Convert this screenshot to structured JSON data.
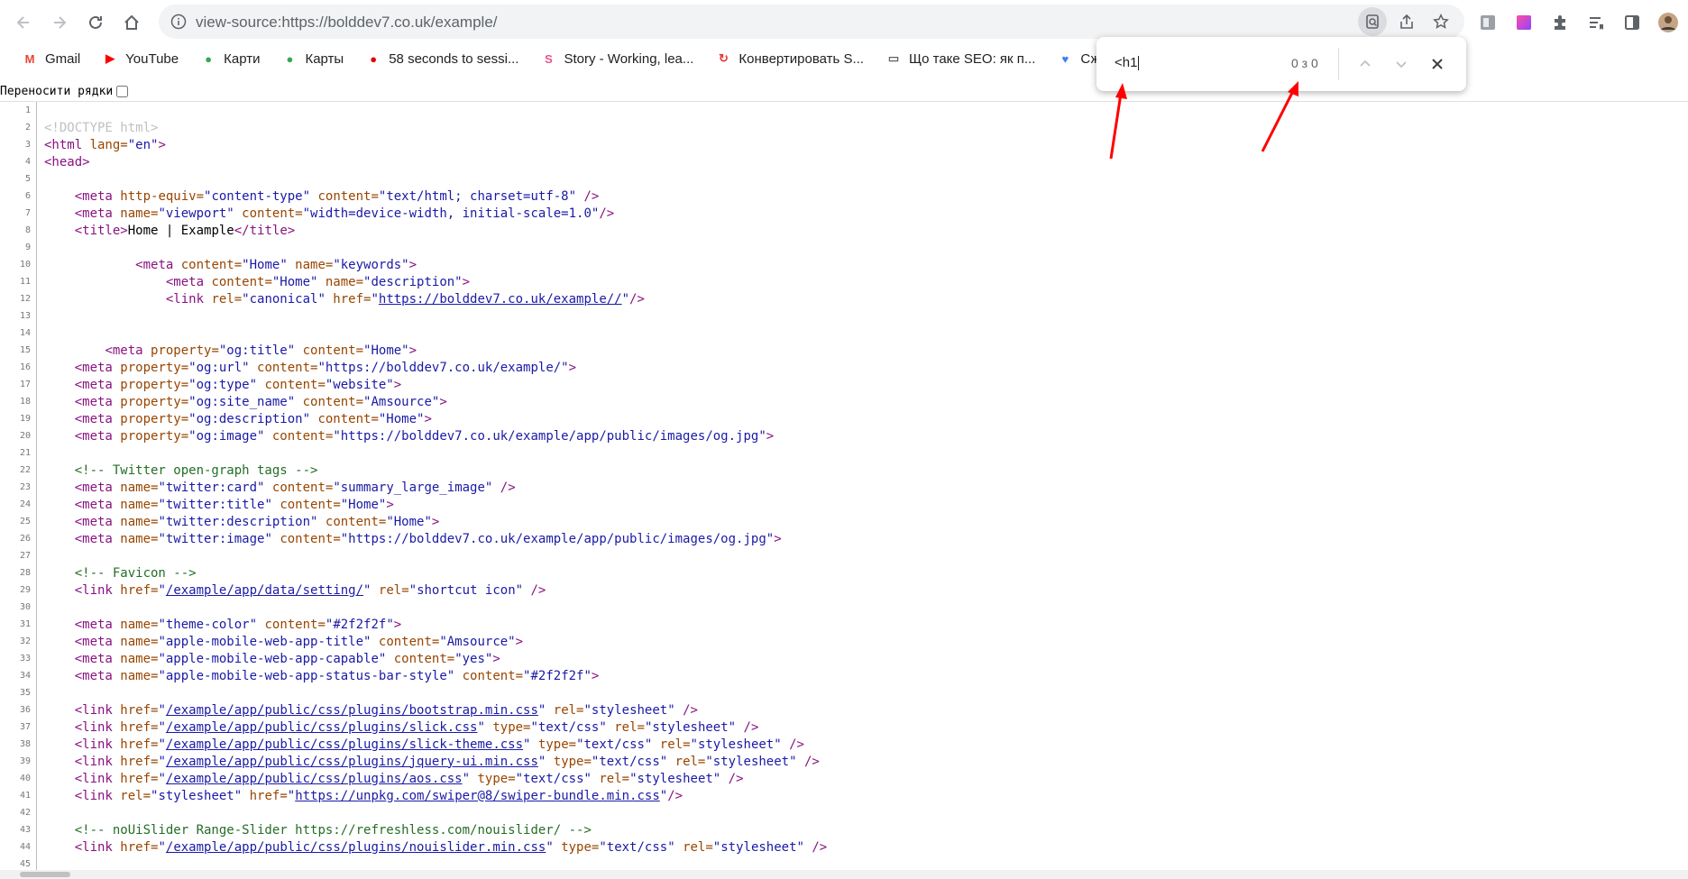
{
  "browser": {
    "url": "view-source:https://bolddev7.co.uk/example/",
    "back_icon": "back-arrow-icon",
    "forward_icon": "forward-arrow-icon",
    "reload_icon": "reload-icon",
    "home_icon": "home-icon"
  },
  "bookmarks": [
    {
      "label": "Gmail",
      "icon": "gmail-icon",
      "color": "#ea4335",
      "glyph": "M"
    },
    {
      "label": "YouTube",
      "icon": "youtube-icon",
      "color": "#ff0000",
      "glyph": "▶"
    },
    {
      "label": "Карти",
      "icon": "maps-pin-icon",
      "color": "#34a853",
      "glyph": "●"
    },
    {
      "label": "Карты",
      "icon": "maps-pin-icon",
      "color": "#34a853",
      "glyph": "●"
    },
    {
      "label": "58 seconds to sessi...",
      "icon": "red-circle-icon",
      "color": "#e00000",
      "glyph": "●"
    },
    {
      "label": "Story - Working, lea...",
      "icon": "story-icon",
      "color": "#e8538f",
      "glyph": "S"
    },
    {
      "label": "Конвертировать S...",
      "icon": "convert-icon",
      "color": "#e53935",
      "glyph": "↻"
    },
    {
      "label": "Що таке SEO: як п...",
      "icon": "monitor-icon",
      "color": "#5f6368",
      "glyph": "▭"
    },
    {
      "label": "Сжать",
      "icon": "heart-icon",
      "color": "#3b82f6",
      "glyph": "♥"
    }
  ],
  "wrap_label": "Переносити рядки",
  "find": {
    "query": "<h1",
    "count": "0 з 0"
  },
  "annotation_color": "#ff0000",
  "code_lines": [
    {
      "n": "1",
      "t": []
    },
    {
      "n": "2",
      "t": [
        [
          "doc",
          "<!DOCTYPE html>"
        ]
      ]
    },
    {
      "n": "3",
      "t": [
        [
          "tag",
          "<html "
        ],
        [
          "attr",
          "lang="
        ],
        [
          "val",
          "\"en\""
        ],
        [
          "tag",
          ">"
        ]
      ]
    },
    {
      "n": "4",
      "t": [
        [
          "tag",
          "<head>"
        ]
      ]
    },
    {
      "n": "5",
      "t": []
    },
    {
      "n": "6",
      "t": [
        [
          "txt",
          "    "
        ],
        [
          "tag",
          "<meta "
        ],
        [
          "attr",
          "http-equiv="
        ],
        [
          "val",
          "\"content-type\""
        ],
        [
          "attr",
          " content="
        ],
        [
          "val",
          "\"text/html; charset=utf-8\""
        ],
        [
          "tag",
          " />"
        ]
      ]
    },
    {
      "n": "7",
      "t": [
        [
          "txt",
          "    "
        ],
        [
          "tag",
          "<meta "
        ],
        [
          "attr",
          "name="
        ],
        [
          "val",
          "\"viewport\""
        ],
        [
          "attr",
          " content="
        ],
        [
          "val",
          "\"width=device-width, initial-scale=1.0\""
        ],
        [
          "tag",
          "/>"
        ]
      ]
    },
    {
      "n": "8",
      "t": [
        [
          "txt",
          "    "
        ],
        [
          "tag",
          "<title>"
        ],
        [
          "txt",
          "Home | Example"
        ],
        [
          "tag",
          "</title>"
        ]
      ]
    },
    {
      "n": "9",
      "t": []
    },
    {
      "n": "10",
      "t": [
        [
          "txt",
          "            "
        ],
        [
          "tag",
          "<meta "
        ],
        [
          "attr",
          "content="
        ],
        [
          "val",
          "\"Home\""
        ],
        [
          "attr",
          " name="
        ],
        [
          "val",
          "\"keywords\""
        ],
        [
          "tag",
          ">"
        ]
      ]
    },
    {
      "n": "11",
      "t": [
        [
          "txt",
          "                "
        ],
        [
          "tag",
          "<meta "
        ],
        [
          "attr",
          "content="
        ],
        [
          "val",
          "\"Home\""
        ],
        [
          "attr",
          " name="
        ],
        [
          "val",
          "\"description\""
        ],
        [
          "tag",
          ">"
        ]
      ]
    },
    {
      "n": "12",
      "t": [
        [
          "txt",
          "                "
        ],
        [
          "tag",
          "<link "
        ],
        [
          "attr",
          "rel="
        ],
        [
          "val",
          "\"canonical\""
        ],
        [
          "attr",
          " href="
        ],
        [
          "val",
          "\""
        ],
        [
          "lnk",
          "https://bolddev7.co.uk/example//"
        ],
        [
          "val",
          "\""
        ],
        [
          "tag",
          "/>"
        ]
      ]
    },
    {
      "n": "13",
      "t": []
    },
    {
      "n": "14",
      "t": []
    },
    {
      "n": "15",
      "t": [
        [
          "txt",
          "        "
        ],
        [
          "tag",
          "<meta "
        ],
        [
          "attr",
          "property="
        ],
        [
          "val",
          "\"og:title\""
        ],
        [
          "attr",
          " content="
        ],
        [
          "val",
          "\"Home\""
        ],
        [
          "tag",
          ">"
        ]
      ]
    },
    {
      "n": "16",
      "t": [
        [
          "txt",
          "    "
        ],
        [
          "tag",
          "<meta "
        ],
        [
          "attr",
          "property="
        ],
        [
          "val",
          "\"og:url\""
        ],
        [
          "attr",
          " content="
        ],
        [
          "val",
          "\"https://bolddev7.co.uk/example/\""
        ],
        [
          "tag",
          ">"
        ]
      ]
    },
    {
      "n": "17",
      "t": [
        [
          "txt",
          "    "
        ],
        [
          "tag",
          "<meta "
        ],
        [
          "attr",
          "property="
        ],
        [
          "val",
          "\"og:type\""
        ],
        [
          "attr",
          " content="
        ],
        [
          "val",
          "\"website\""
        ],
        [
          "tag",
          ">"
        ]
      ]
    },
    {
      "n": "18",
      "t": [
        [
          "txt",
          "    "
        ],
        [
          "tag",
          "<meta "
        ],
        [
          "attr",
          "property="
        ],
        [
          "val",
          "\"og:site_name\""
        ],
        [
          "attr",
          " content="
        ],
        [
          "val",
          "\"Amsource\""
        ],
        [
          "tag",
          ">"
        ]
      ]
    },
    {
      "n": "19",
      "t": [
        [
          "txt",
          "    "
        ],
        [
          "tag",
          "<meta "
        ],
        [
          "attr",
          "property="
        ],
        [
          "val",
          "\"og:description\""
        ],
        [
          "attr",
          " content="
        ],
        [
          "val",
          "\"Home\""
        ],
        [
          "tag",
          ">"
        ]
      ]
    },
    {
      "n": "20",
      "t": [
        [
          "txt",
          "    "
        ],
        [
          "tag",
          "<meta "
        ],
        [
          "attr",
          "property="
        ],
        [
          "val",
          "\"og:image\""
        ],
        [
          "attr",
          " content="
        ],
        [
          "val",
          "\"https://bolddev7.co.uk/example/app/public/images/og.jpg\""
        ],
        [
          "tag",
          ">"
        ]
      ]
    },
    {
      "n": "21",
      "t": []
    },
    {
      "n": "22",
      "t": [
        [
          "txt",
          "    "
        ],
        [
          "com",
          "<!-- Twitter open-graph tags -->"
        ]
      ]
    },
    {
      "n": "23",
      "t": [
        [
          "txt",
          "    "
        ],
        [
          "tag",
          "<meta "
        ],
        [
          "attr",
          "name="
        ],
        [
          "val",
          "\"twitter:card\""
        ],
        [
          "attr",
          " content="
        ],
        [
          "val",
          "\"summary_large_image\""
        ],
        [
          "tag",
          " />"
        ]
      ]
    },
    {
      "n": "24",
      "t": [
        [
          "txt",
          "    "
        ],
        [
          "tag",
          "<meta "
        ],
        [
          "attr",
          "name="
        ],
        [
          "val",
          "\"twitter:title\""
        ],
        [
          "attr",
          " content="
        ],
        [
          "val",
          "\"Home\""
        ],
        [
          "tag",
          ">"
        ]
      ]
    },
    {
      "n": "25",
      "t": [
        [
          "txt",
          "    "
        ],
        [
          "tag",
          "<meta "
        ],
        [
          "attr",
          "name="
        ],
        [
          "val",
          "\"twitter:description\""
        ],
        [
          "attr",
          " content="
        ],
        [
          "val",
          "\"Home\""
        ],
        [
          "tag",
          ">"
        ]
      ]
    },
    {
      "n": "26",
      "t": [
        [
          "txt",
          "    "
        ],
        [
          "tag",
          "<meta "
        ],
        [
          "attr",
          "name="
        ],
        [
          "val",
          "\"twitter:image\""
        ],
        [
          "attr",
          " content="
        ],
        [
          "val",
          "\"https://bolddev7.co.uk/example/app/public/images/og.jpg\""
        ],
        [
          "tag",
          ">"
        ]
      ]
    },
    {
      "n": "27",
      "t": []
    },
    {
      "n": "28",
      "t": [
        [
          "txt",
          "    "
        ],
        [
          "com",
          "<!-- Favicon -->"
        ]
      ]
    },
    {
      "n": "29",
      "t": [
        [
          "txt",
          "    "
        ],
        [
          "tag",
          "<link "
        ],
        [
          "attr",
          "href="
        ],
        [
          "val",
          "\""
        ],
        [
          "lnk",
          "/example/app/data/setting/"
        ],
        [
          "val",
          "\""
        ],
        [
          "attr",
          " rel="
        ],
        [
          "val",
          "\"shortcut icon\""
        ],
        [
          "tag",
          " />"
        ]
      ]
    },
    {
      "n": "30",
      "t": []
    },
    {
      "n": "31",
      "t": [
        [
          "txt",
          "    "
        ],
        [
          "tag",
          "<meta "
        ],
        [
          "attr",
          "name="
        ],
        [
          "val",
          "\"theme-color\""
        ],
        [
          "attr",
          " content="
        ],
        [
          "val",
          "\"#2f2f2f\""
        ],
        [
          "tag",
          ">"
        ]
      ]
    },
    {
      "n": "32",
      "t": [
        [
          "txt",
          "    "
        ],
        [
          "tag",
          "<meta "
        ],
        [
          "attr",
          "name="
        ],
        [
          "val",
          "\"apple-mobile-web-app-title\""
        ],
        [
          "attr",
          " content="
        ],
        [
          "val",
          "\"Amsource\""
        ],
        [
          "tag",
          ">"
        ]
      ]
    },
    {
      "n": "33",
      "t": [
        [
          "txt",
          "    "
        ],
        [
          "tag",
          "<meta "
        ],
        [
          "attr",
          "name="
        ],
        [
          "val",
          "\"apple-mobile-web-app-capable\""
        ],
        [
          "attr",
          " content="
        ],
        [
          "val",
          "\"yes\""
        ],
        [
          "tag",
          ">"
        ]
      ]
    },
    {
      "n": "34",
      "t": [
        [
          "txt",
          "    "
        ],
        [
          "tag",
          "<meta "
        ],
        [
          "attr",
          "name="
        ],
        [
          "val",
          "\"apple-mobile-web-app-status-bar-style\""
        ],
        [
          "attr",
          " content="
        ],
        [
          "val",
          "\"#2f2f2f\""
        ],
        [
          "tag",
          ">"
        ]
      ]
    },
    {
      "n": "35",
      "t": []
    },
    {
      "n": "36",
      "t": [
        [
          "txt",
          "    "
        ],
        [
          "tag",
          "<link "
        ],
        [
          "attr",
          "href="
        ],
        [
          "val",
          "\""
        ],
        [
          "lnk",
          "/example/app/public/css/plugins/bootstrap.min.css"
        ],
        [
          "val",
          "\""
        ],
        [
          "attr",
          " rel="
        ],
        [
          "val",
          "\"stylesheet\""
        ],
        [
          "tag",
          " />"
        ]
      ]
    },
    {
      "n": "37",
      "t": [
        [
          "txt",
          "    "
        ],
        [
          "tag",
          "<link "
        ],
        [
          "attr",
          "href="
        ],
        [
          "val",
          "\""
        ],
        [
          "lnk",
          "/example/app/public/css/plugins/slick.css"
        ],
        [
          "val",
          "\""
        ],
        [
          "attr",
          " type="
        ],
        [
          "val",
          "\"text/css\""
        ],
        [
          "attr",
          " rel="
        ],
        [
          "val",
          "\"stylesheet\""
        ],
        [
          "tag",
          " />"
        ]
      ]
    },
    {
      "n": "38",
      "t": [
        [
          "txt",
          "    "
        ],
        [
          "tag",
          "<link "
        ],
        [
          "attr",
          "href="
        ],
        [
          "val",
          "\""
        ],
        [
          "lnk",
          "/example/app/public/css/plugins/slick-theme.css"
        ],
        [
          "val",
          "\""
        ],
        [
          "attr",
          " type="
        ],
        [
          "val",
          "\"text/css\""
        ],
        [
          "attr",
          " rel="
        ],
        [
          "val",
          "\"stylesheet\""
        ],
        [
          "tag",
          " />"
        ]
      ]
    },
    {
      "n": "39",
      "t": [
        [
          "txt",
          "    "
        ],
        [
          "tag",
          "<link "
        ],
        [
          "attr",
          "href="
        ],
        [
          "val",
          "\""
        ],
        [
          "lnk",
          "/example/app/public/css/plugins/jquery-ui.min.css"
        ],
        [
          "val",
          "\""
        ],
        [
          "attr",
          " type="
        ],
        [
          "val",
          "\"text/css\""
        ],
        [
          "attr",
          " rel="
        ],
        [
          "val",
          "\"stylesheet\""
        ],
        [
          "tag",
          " />"
        ]
      ]
    },
    {
      "n": "40",
      "t": [
        [
          "txt",
          "    "
        ],
        [
          "tag",
          "<link "
        ],
        [
          "attr",
          "href="
        ],
        [
          "val",
          "\""
        ],
        [
          "lnk",
          "/example/app/public/css/plugins/aos.css"
        ],
        [
          "val",
          "\""
        ],
        [
          "attr",
          " type="
        ],
        [
          "val",
          "\"text/css\""
        ],
        [
          "attr",
          " rel="
        ],
        [
          "val",
          "\"stylesheet\""
        ],
        [
          "tag",
          " />"
        ]
      ]
    },
    {
      "n": "41",
      "t": [
        [
          "txt",
          "    "
        ],
        [
          "tag",
          "<link "
        ],
        [
          "attr",
          "rel="
        ],
        [
          "val",
          "\"stylesheet\""
        ],
        [
          "attr",
          " href="
        ],
        [
          "val",
          "\""
        ],
        [
          "lnk",
          "https://unpkg.com/swiper@8/swiper-bundle.min.css"
        ],
        [
          "val",
          "\""
        ],
        [
          "tag",
          "/>"
        ]
      ]
    },
    {
      "n": "42",
      "t": []
    },
    {
      "n": "43",
      "t": [
        [
          "txt",
          "    "
        ],
        [
          "com",
          "<!-- noUiSlider Range-Slider https://refreshless.com/nouislider/ -->"
        ]
      ]
    },
    {
      "n": "44",
      "t": [
        [
          "txt",
          "    "
        ],
        [
          "tag",
          "<link "
        ],
        [
          "attr",
          "href="
        ],
        [
          "val",
          "\""
        ],
        [
          "lnk",
          "/example/app/public/css/plugins/nouislider.min.css"
        ],
        [
          "val",
          "\""
        ],
        [
          "attr",
          " type="
        ],
        [
          "val",
          "\"text/css\""
        ],
        [
          "attr",
          " rel="
        ],
        [
          "val",
          "\"stylesheet\""
        ],
        [
          "tag",
          " />"
        ]
      ]
    },
    {
      "n": "45",
      "t": []
    }
  ]
}
